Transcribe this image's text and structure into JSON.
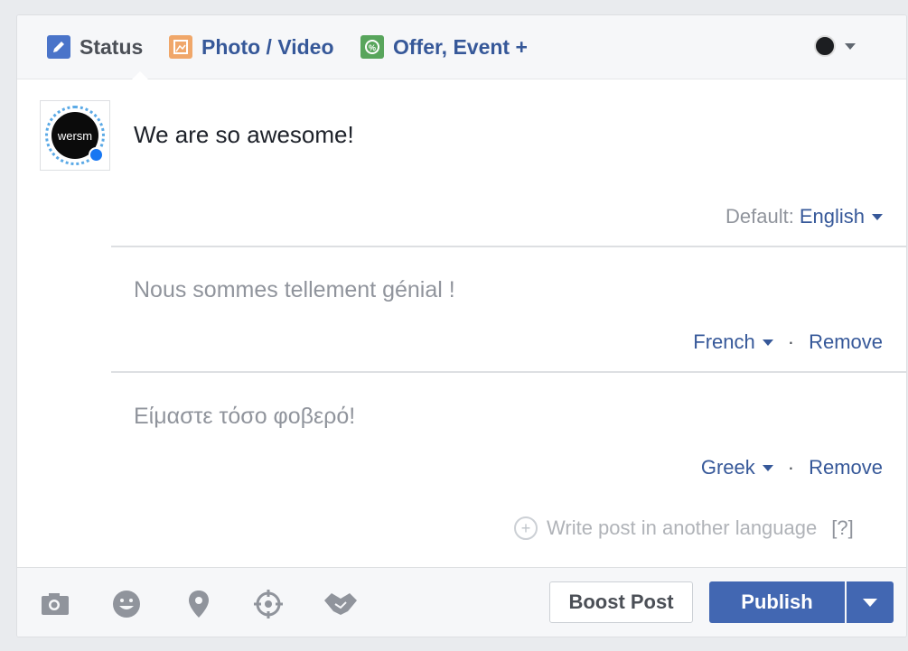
{
  "tabs": {
    "status": "Status",
    "photo_video": "Photo / Video",
    "offer_event": "Offer, Event +"
  },
  "avatar": {
    "text": "wersm"
  },
  "post": {
    "main_text": "We are so awesome!",
    "default_label": "Default:",
    "default_language": "English"
  },
  "translations": [
    {
      "text": "Nous sommes tellement génial !",
      "language": "French",
      "remove": "Remove"
    },
    {
      "text": "Είμαστε τόσο φοβερό!",
      "language": "Greek",
      "remove": "Remove"
    }
  ],
  "separator": "·",
  "write_another": {
    "label": "Write post in another language",
    "help": "[?]"
  },
  "footer": {
    "boost_label": "Boost Post",
    "publish_label": "Publish",
    "icons": [
      "camera-icon",
      "emoji-icon",
      "location-pin-icon",
      "target-icon",
      "handshake-icon"
    ]
  },
  "colors": {
    "link": "#365899",
    "primary_button": "#4267b2"
  }
}
